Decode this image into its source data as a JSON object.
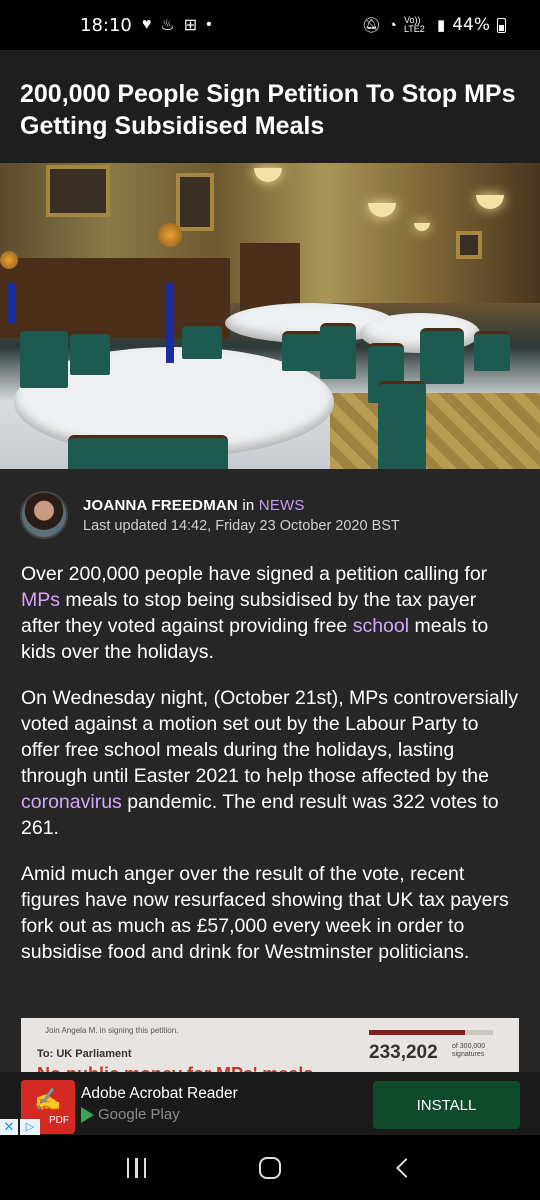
{
  "status": {
    "time": "18:10",
    "icons_left": [
      "heart-icon",
      "notification-icon",
      "teams-icon",
      "dot-icon"
    ],
    "network": "Vo)) LTE2",
    "battery": "44%"
  },
  "article": {
    "headline": "200,000 People Sign Petition To Stop MPs Getting Subsidised Meals",
    "author": "JOANNA FREEDMAN",
    "in_word": "in",
    "category": "NEWS",
    "updated": "Last updated 14:42, Friday 23 October 2020 BST",
    "p1": {
      "a": "Over 200,000 people have signed a petition calling for ",
      "link1": "MPs",
      "b": " meals to stop being subsidised by the tax payer after they voted against providing free ",
      "link2": "school",
      "c": " meals to kids over the holidays."
    },
    "p2": {
      "a": "On Wednesday night, (October 21st), MPs controversially voted against a motion set out by the Labour Party to offer free school meals during the holidays, lasting through until Easter 2021 to help those affected by the ",
      "link1": "coronavirus",
      "b": " pandemic. The end result was 322 votes to 261."
    },
    "p3": "Amid much anger over the result of the vote, recent figures have now resurfaced showing that UK tax payers fork out as much as £57,000 every week in order to subsidise food and drink for Westminster politicians."
  },
  "embed": {
    "join_text": "Join Angela M. in signing this petition.",
    "to_text": "To: UK Parliament",
    "title_partial": "No public money for MPs' meals",
    "count": "233,202",
    "of_text": "of 300,000",
    "sig_text": "signatures",
    "progress_fraction": 0.777
  },
  "ad": {
    "app_name": "Adobe Acrobat Reader",
    "store": "Google Play",
    "cta": "INSTALL",
    "icon_label": "PDF"
  }
}
